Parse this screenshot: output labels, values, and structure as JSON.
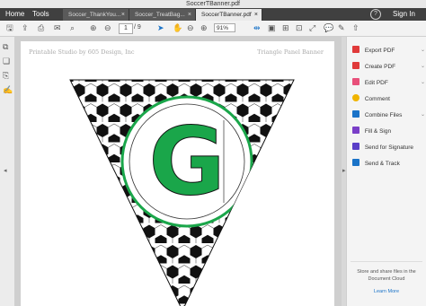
{
  "window": {
    "title": "SoccerTBanner.pdf"
  },
  "nav": {
    "home": "Home",
    "tools": "Tools"
  },
  "tabs": [
    {
      "label": "Soccer_ThankYou...",
      "close": "×",
      "active": false
    },
    {
      "label": "Soccer_TreatBag...",
      "close": "×",
      "active": false
    },
    {
      "label": "SoccerTBanner.pdf",
      "close": "×",
      "active": true
    }
  ],
  "account": {
    "help": "?",
    "signin": "Sign In"
  },
  "toolbar": {
    "page_current": "1",
    "page_total": "/ 9",
    "zoom": "91%"
  },
  "document": {
    "header_left": "Printable Studio by 605 Design, Inc",
    "header_right": "Triangle Panel Banner",
    "letter": "G",
    "colors": {
      "letter": "#1aa64a",
      "ring": "#1aa64a"
    }
  },
  "right_panel": {
    "items": [
      {
        "label": "Export PDF",
        "color": "#e03a3a"
      },
      {
        "label": "Create PDF",
        "color": "#e03a3a"
      },
      {
        "label": "Edit PDF",
        "color": "#e8507a"
      },
      {
        "label": "Comment",
        "color": "#f0b400"
      },
      {
        "label": "Combine Files",
        "color": "#1a73c8"
      },
      {
        "label": "Fill & Sign",
        "color": "#7a3fc8"
      },
      {
        "label": "Send for Signature",
        "color": "#5a3fc8"
      },
      {
        "label": "Send & Track",
        "color": "#1a73c8"
      }
    ],
    "cloud_text": "Store and share files in the Document Cloud",
    "learn_more": "Learn More"
  }
}
